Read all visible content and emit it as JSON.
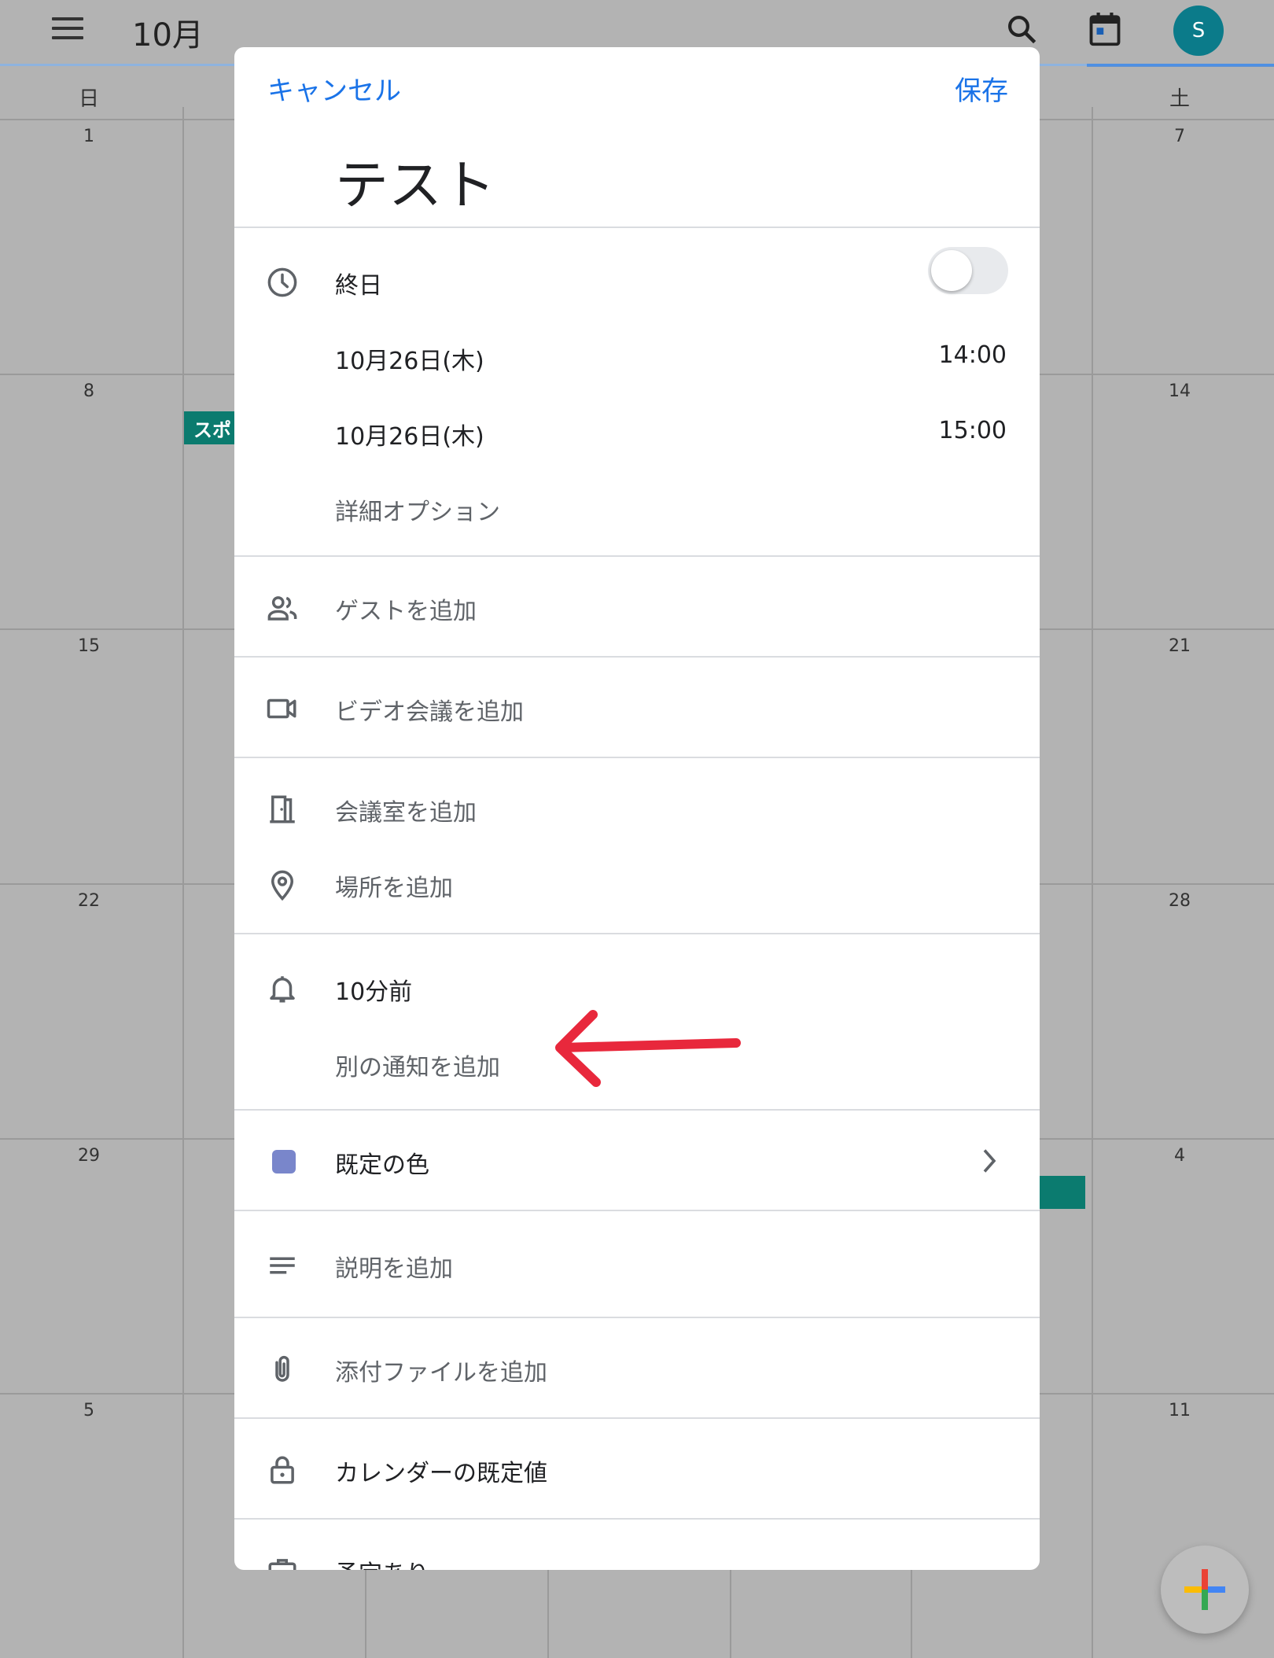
{
  "app_bar": {
    "month": "10月",
    "avatar_letter": "S"
  },
  "weekdays": {
    "sun": "日",
    "sat": "土"
  },
  "calendar": {
    "day_numbers": [
      "1",
      "7",
      "8",
      "14",
      "15",
      "21",
      "22",
      "28",
      "29",
      "4",
      "5",
      "11"
    ],
    "event_chip": "スポ"
  },
  "dialog": {
    "cancel": "キャンセル",
    "save": "保存",
    "title": "テスト",
    "all_day": "終日",
    "start_date": "10月26日(木)",
    "start_time": "14:00",
    "end_date": "10月26日(木)",
    "end_time": "15:00",
    "more_options": "詳細オプション",
    "add_guests": "ゲストを追加",
    "add_video": "ビデオ会議を追加",
    "add_room": "会議室を追加",
    "add_location": "場所を追加",
    "notification": "10分前",
    "add_notification": "別の通知を追加",
    "color": "既定の色",
    "add_description": "説明を追加",
    "add_attachment": "添付ファイルを追加",
    "visibility": "カレンダーの既定値",
    "availability": "予定あり"
  },
  "colors": {
    "accent": "#1a73e8",
    "event_color": "#7986cb",
    "annotation_arrow": "#e8283c"
  }
}
